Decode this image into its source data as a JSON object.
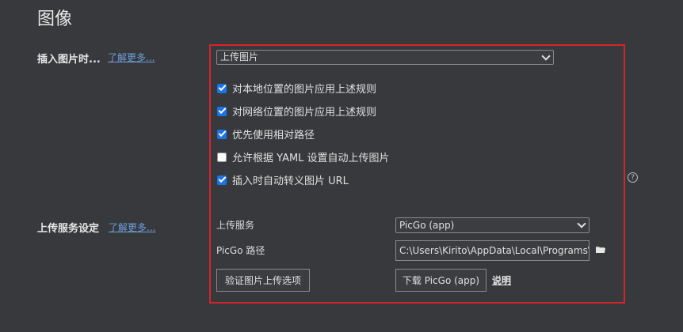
{
  "page": {
    "title": "图像"
  },
  "insert": {
    "label": "插入图片时...",
    "learn_more": "了解更多...",
    "action_value": "上传图片",
    "options": [
      {
        "label": "对本地位置的图片应用上述规则",
        "checked": true
      },
      {
        "label": "对网络位置的图片应用上述规则",
        "checked": true
      },
      {
        "label": "优先使用相对路径",
        "checked": true
      },
      {
        "label": "允许根据 YAML 设置自动上传图片",
        "checked": false
      },
      {
        "label": "插入时自动转义图片 URL",
        "checked": true
      }
    ]
  },
  "upload": {
    "label": "上传服务设定",
    "learn_more": "了解更多...",
    "service_label": "上传服务",
    "service_value": "PicGo (app)",
    "path_label": "PicGo 路径",
    "path_value": "C:\\Users\\Kirito\\AppData\\Local\\Programs\\PicGo",
    "verify_button": "验证图片上传选项",
    "download_button": "下载 PicGo (app)",
    "doc_link": "说明"
  },
  "colors": {
    "highlight_border": "#d4242c",
    "link": "#6c9edb",
    "checkbox_on": "#1a73e8"
  }
}
